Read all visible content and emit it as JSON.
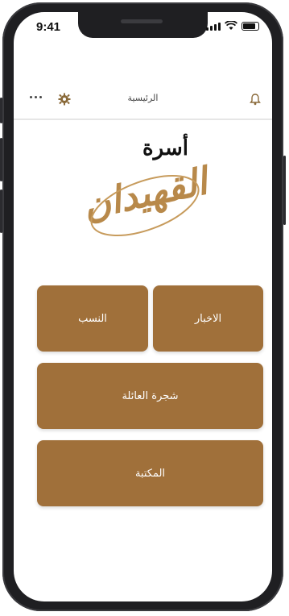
{
  "status": {
    "time": "9:41"
  },
  "header": {
    "title": "الرئيسية"
  },
  "logo": {
    "top_text": "أسرة",
    "main_text": "القهيدان"
  },
  "buttons": {
    "news": "الاخبار",
    "lineage": "النسب",
    "family_tree": "شجرة العائلة",
    "library": "المكتبة"
  },
  "colors": {
    "button": "#a0703a",
    "logo_gold": "#b8894a",
    "frame": "#1f1f22"
  },
  "icons": [
    "more-icon",
    "gear-icon",
    "bell-icon",
    "signal-icon",
    "wifi-icon",
    "battery-icon"
  ]
}
